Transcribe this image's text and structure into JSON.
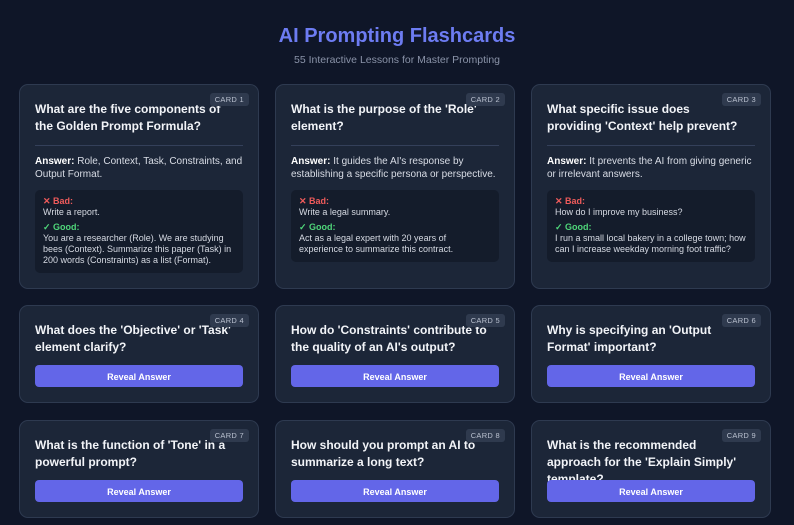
{
  "header": {
    "title": "AI Prompting Flashcards",
    "subtitle": "55 Interactive Lessons for Master Prompting"
  },
  "reveal_label": "Reveal Answer",
  "answer_prefix": "Answer:",
  "bad_prefix": "✕ Bad:",
  "good_prefix": "✓ Good:",
  "colors": {
    "background": "#0f1628",
    "card": "#1c2638",
    "accent": "#6366e8",
    "title": "#6d7cf2",
    "bad": "#ef5b5b",
    "good": "#4fd67a"
  },
  "cards": [
    {
      "badge": "CARD 1",
      "question": "What are the five components of the Golden Prompt Formula?",
      "answer": "Role, Context, Task, Constraints, and Output Format.",
      "bad": "Write a report.",
      "good": "You are a researcher (Role). We are studying bees (Context). Summarize this paper (Task) in 200 words (Constraints) as a list (Format)."
    },
    {
      "badge": "CARD 2",
      "question": "What is the purpose of the 'Role' element?",
      "answer": "It guides the AI's response by establishing a specific persona or perspective.",
      "bad": "Write a legal summary.",
      "good": "Act as a legal expert with 20 years of experience to summarize this contract."
    },
    {
      "badge": "CARD 3",
      "question": "What specific issue does providing 'Context' help prevent?",
      "answer": "It prevents the AI from giving generic or irrelevant answers.",
      "bad": "How do I improve my business?",
      "good": "I run a small local bakery in a college town; how can I increase weekday morning foot traffic?"
    },
    {
      "badge": "CARD 4",
      "question": "What does the 'Objective' or 'Task' element clarify?"
    },
    {
      "badge": "CARD 5",
      "question": "How do 'Constraints' contribute to the quality of an AI's output?"
    },
    {
      "badge": "CARD 6",
      "question": "Why is specifying an 'Output Format' important?"
    },
    {
      "badge": "CARD 7",
      "question": "What is the function of 'Tone' in a powerful prompt?"
    },
    {
      "badge": "CARD 8",
      "question": "How should you prompt an AI to summarize a long text?"
    },
    {
      "badge": "CARD 9",
      "question": "What is the recommended approach for the 'Explain Simply' template?"
    }
  ]
}
